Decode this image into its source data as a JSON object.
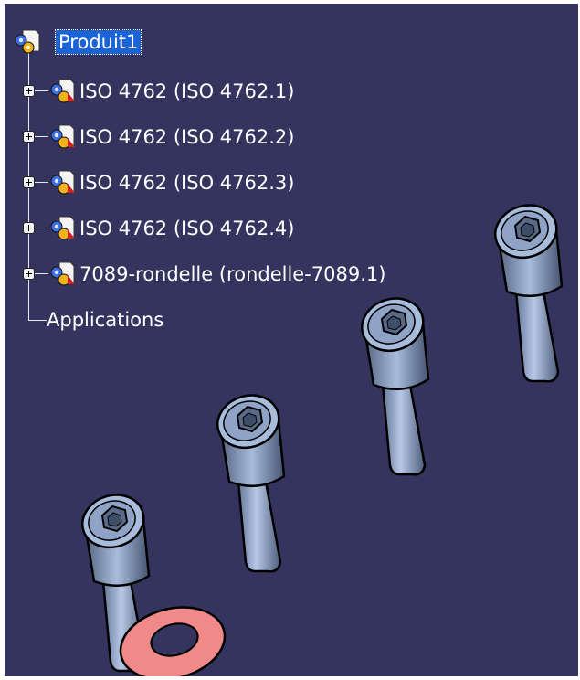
{
  "tree": {
    "root": {
      "label": "Produit1",
      "icon": "product-icon"
    },
    "children": [
      {
        "label": "ISO 4762 (ISO 4762.1)",
        "icon": "part-icon"
      },
      {
        "label": "ISO 4762 (ISO 4762.2)",
        "icon": "part-icon"
      },
      {
        "label": "ISO 4762 (ISO 4762.3)",
        "icon": "part-icon"
      },
      {
        "label": "ISO 4762 (ISO 4762.4)",
        "icon": "part-icon"
      },
      {
        "label": "7089-rondelle (rondelle-7089.1)",
        "icon": "part-icon"
      }
    ],
    "applications": {
      "label": "Applications"
    }
  },
  "colors": {
    "viewport_background": "#34345e",
    "screw_body": "#9db3d6",
    "washer": "#f08a8a",
    "selection": "#1c63d6"
  }
}
